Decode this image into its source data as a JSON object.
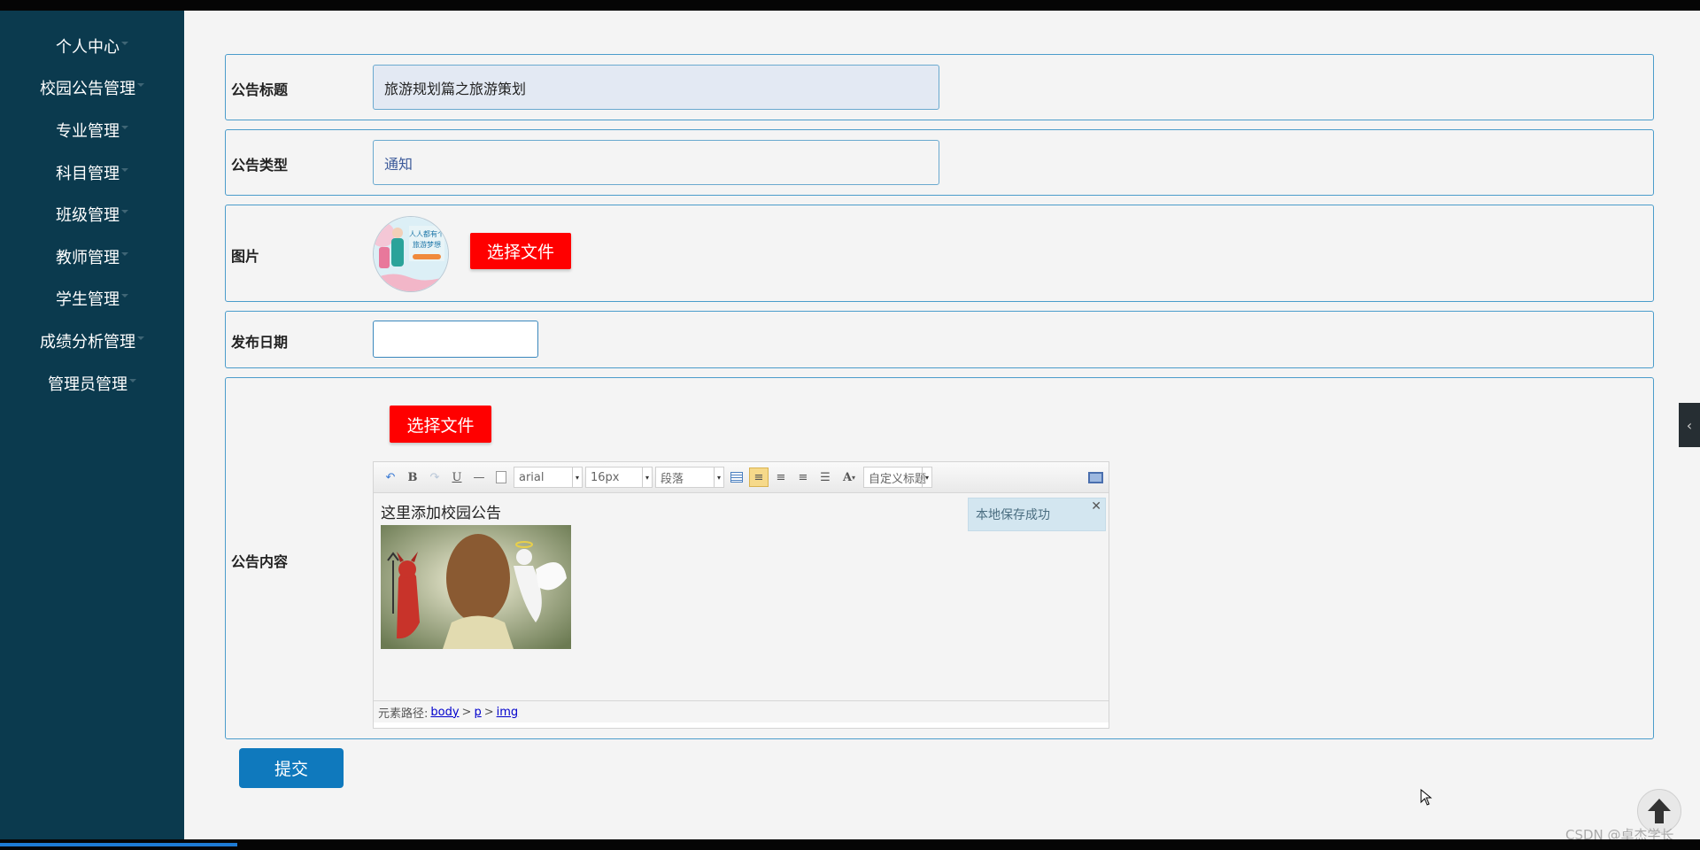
{
  "sidebar": {
    "items": [
      {
        "label": "个人中心"
      },
      {
        "label": "校园公告管理"
      },
      {
        "label": "专业管理"
      },
      {
        "label": "科目管理"
      },
      {
        "label": "班级管理"
      },
      {
        "label": "教师管理"
      },
      {
        "label": "学生管理"
      },
      {
        "label": "成绩分析管理"
      },
      {
        "label": "管理员管理"
      }
    ]
  },
  "form": {
    "title": {
      "label": "公告标题",
      "value": "旅游规划篇之旅游策划"
    },
    "type": {
      "label": "公告类型",
      "value": "通知"
    },
    "image": {
      "label": "图片",
      "button": "选择文件",
      "thumb_text": "人人都有个旅游梦想"
    },
    "date": {
      "label": "发布日期",
      "value": ""
    },
    "content": {
      "label": "公告内容",
      "upload_button": "选择文件",
      "toolbar": {
        "font": "arial",
        "size": "16px",
        "paragraph": "段落",
        "custom_title": "自定义标题",
        "text_color_icon": "A"
      },
      "body_text": "这里添加校园公告",
      "toast": "本地保存成功",
      "path": {
        "prefix": "元素路径:",
        "items": [
          "body",
          "p",
          "img"
        ]
      }
    },
    "submit": "提交"
  },
  "watermark": "CSDN @卓杰学长",
  "colors": {
    "sidebar": "#0b3a4e",
    "accent": "#0f79bd",
    "danger": "#ff0000",
    "border": "#4b9ccb"
  }
}
